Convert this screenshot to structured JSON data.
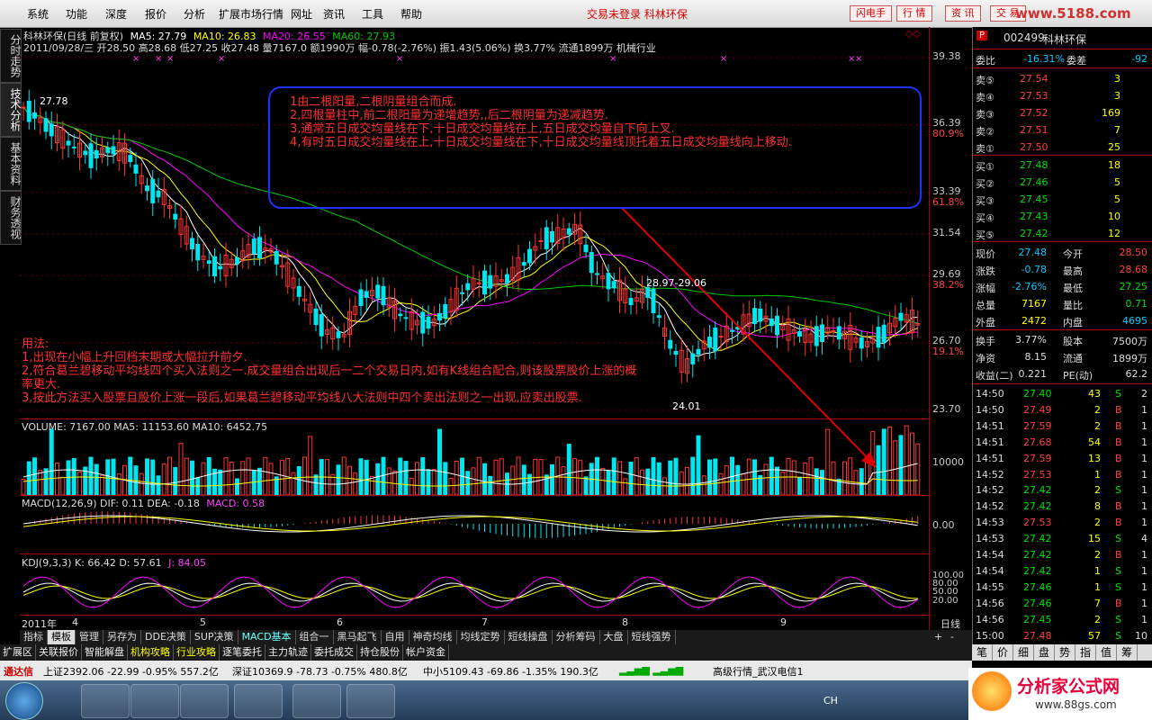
{
  "menu": {
    "items": [
      "系统",
      "功能",
      "深度",
      "报价",
      "分析",
      "扩展市场行情",
      "网址",
      "资讯",
      "工具",
      "帮助"
    ],
    "status_title": "交易未登录  科林环保",
    "right_buttons": [
      "闪电手",
      "行 情",
      "资 讯",
      "交 易"
    ],
    "watermark": "www.5188.com"
  },
  "left_tabs": [
    "分时走势",
    "技术分析",
    "基本资料",
    "财务透视"
  ],
  "chart": {
    "header": "科林环保(日线 前复权) MA5: 27.79  MA10: 26.83  MA20: 26.55  MA60: 27.93",
    "header_parts": {
      "name": "科林环保(日线 前复权)",
      "ma5": "MA5: 27.79",
      "ma10": "MA10: 26.83",
      "ma20": "MA20: 26.55",
      "ma60": "MA60: 27.93"
    },
    "info_line": "2011/09/28/三  开28.50  高28.68  低27.25  收27.48  量7167.0  额1990万  幅-0.78(-2.76%)  振1.43(5.06%)  换3.77%  流通1899万  机械行业",
    "price_labels": [
      {
        "v": "39.38"
      },
      {
        "v": "36.39"
      },
      {
        "v": "80.9%",
        "red": true
      },
      {
        "v": "33.39"
      },
      {
        "v": "61.8%",
        "red": true
      },
      {
        "v": "31.54"
      },
      {
        "v": "29.69"
      },
      {
        "v": "38.2%",
        "red": true
      },
      {
        "v": "26.70"
      },
      {
        "v": "19.1%",
        "red": true
      },
      {
        "v": "23.70"
      }
    ],
    "peak_label": "27.78",
    "range_label": "28.97-29.06",
    "low_label": "24.01",
    "x_labels": [
      "2011年",
      "4",
      "5",
      "6",
      "7",
      "8",
      "9"
    ],
    "x_right": "日线"
  },
  "notes": [
    "1由二根阳量,二根阴量组合而成.",
    "2,四根量柱中,前二根阳量为递增趋势,,后二根阴量为递减趋势.",
    "3,通常五日成交均量线在下,十日成交均量线在上,五日成交均量自下向上叉.",
    "4,有时五日成交均量线在上,十日成交均量线在下,十日成交均量线顶托着五日成交均量线向上移动."
  ],
  "usage": [
    "用法:",
    "1,出现在小幅上升回档末期或大幅拉升前夕.",
    "2,符合葛兰碧移动平均线四个买入法则之一.成交量组合出现后一二个交易日内,如有K线组合配合,则该股票股价上涨的概",
    "率更大.",
    "3,按此方法买入股票且股价上涨一段后,如果葛兰碧移动平均线八大法则中四个卖出法则之一出现,应卖出股票."
  ],
  "volume": {
    "header": "VOLUME: 7167.00  MA5: 11153.60  MA10: 6452.75",
    "label": "10000"
  },
  "macd": {
    "header_main": "MACD(12,26,9)  DIF: 0.11  DEA: -0.18",
    "header_macd": "MACD: 0.58",
    "label": "0.00"
  },
  "kdj": {
    "header_main": "KDJ(9,3,3)  K: 66.42  D: 57.61",
    "header_j": "J: 84.05",
    "labels": [
      "100.00",
      "80.00",
      "50.00",
      "20.00"
    ]
  },
  "tabs1": [
    "指标",
    "模板",
    "管理",
    "另存为",
    "DDE决策",
    "SUP决策",
    "MACD基本",
    "组合一",
    "黑马起飞",
    "自用",
    "神奇均线",
    "均线定势",
    "短线操盘",
    "分析筹码",
    "大盘",
    "短线强势"
  ],
  "tabs2": [
    "扩展区",
    "关联报价",
    "智能解盘",
    "机构攻略",
    "行业攻略",
    "逐笔委托",
    "主力轨迹",
    "委托成交",
    "持仓股份",
    "帐户资金"
  ],
  "statusbar": {
    "brand": "通达信",
    "sh": "上证2392.06  -22.99  -0.95%  557.2亿",
    "sz": "深证10369.9  -78.73  -0.75%  480.8亿",
    "zx": "中小5109.43  -69.86  -1.35%  190.3亿",
    "server": "高级行情_武汉电信1"
  },
  "quote": {
    "code": "002499",
    "name": "科林环保",
    "weibi": "委比",
    "weibi_v": "-16.31%",
    "weicha": "委差",
    "weicha_v": "-92",
    "sell": [
      {
        "l": "卖⑤",
        "p": "27.54",
        "v": "3"
      },
      {
        "l": "卖④",
        "p": "27.53",
        "v": "3"
      },
      {
        "l": "卖③",
        "p": "27.52",
        "v": "169"
      },
      {
        "l": "卖②",
        "p": "27.51",
        "v": "7"
      },
      {
        "l": "卖①",
        "p": "27.50",
        "v": "25"
      }
    ],
    "buy": [
      {
        "l": "买①",
        "p": "27.48",
        "v": "18"
      },
      {
        "l": "买②",
        "p": "27.46",
        "v": "5"
      },
      {
        "l": "买③",
        "p": "27.45",
        "v": "5"
      },
      {
        "l": "买④",
        "p": "27.43",
        "v": "10"
      },
      {
        "l": "买⑤",
        "p": "27.42",
        "v": "12"
      }
    ],
    "stats": [
      [
        "现价",
        "27.48",
        "今开",
        "28.50"
      ],
      [
        "涨跌",
        "-0.78",
        "最高",
        "28.68"
      ],
      [
        "涨幅",
        "-2.76%",
        "最低",
        "27.25"
      ],
      [
        "总量",
        "7167",
        "量比",
        "0.71"
      ],
      [
        "外盘",
        "2472",
        "内盘",
        "4695"
      ]
    ],
    "stats2": [
      [
        "换手",
        "3.77%",
        "股本",
        "7500万"
      ],
      [
        "净资",
        "8.15",
        "流通",
        "1899万"
      ],
      [
        "收益(二)",
        "0.221",
        "PE(动)",
        "62.2"
      ]
    ],
    "ticks": [
      [
        "14:50",
        "27.40",
        "43",
        "S",
        "2"
      ],
      [
        "14:50",
        "27.49",
        "2",
        "B",
        "1"
      ],
      [
        "14:51",
        "27.59",
        "2",
        "B",
        "1"
      ],
      [
        "14:51",
        "27.68",
        "54",
        "B",
        "1"
      ],
      [
        "14:51",
        "27.59",
        "13",
        "B",
        "1"
      ],
      [
        "14:52",
        "27.53",
        "1",
        "B",
        "1"
      ],
      [
        "14:52",
        "27.42",
        "2",
        "S",
        "1"
      ],
      [
        "14:52",
        "27.42",
        "8",
        "B",
        "1"
      ],
      [
        "14:53",
        "27.53",
        "2",
        "B",
        "1"
      ],
      [
        "14:53",
        "27.42",
        "15",
        "S",
        "4"
      ],
      [
        "14:54",
        "27.42",
        "2",
        "B",
        "1"
      ],
      [
        "14:54",
        "27.42",
        "1",
        "S",
        "1"
      ],
      [
        "14:55",
        "27.46",
        "1",
        "S",
        "1"
      ],
      [
        "14:56",
        "27.46",
        "7",
        "B",
        "1"
      ],
      [
        "14:56",
        "27.45",
        "2",
        "S",
        "1"
      ],
      [
        "15:00",
        "27.48",
        "57",
        "S",
        "10"
      ]
    ],
    "bottom_tabs": [
      "笔",
      "价",
      "细",
      "盘",
      "势",
      "指",
      "值",
      "筹"
    ]
  },
  "logo": {
    "text": "分析家公式网",
    "url": "www.88gs.com"
  },
  "colors": {
    "up": "#ff3333",
    "down": "#00e5ee",
    "ma5": "#ffffff",
    "ma10": "#ffff00",
    "ma20": "#ff00ff",
    "ma60": "#00c800",
    "notes": "#ff3030",
    "box": "#2030ff"
  }
}
